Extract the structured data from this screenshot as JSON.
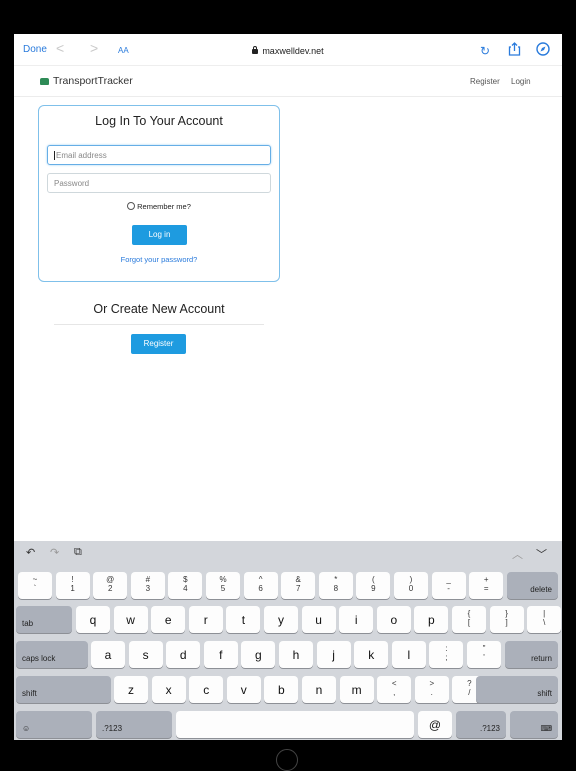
{
  "browser": {
    "done_label": "Done",
    "back_glyph": "<",
    "forward_glyph": ">",
    "text_size_label": "AA",
    "url": "maxwelldev.net",
    "reload_glyph": "↻"
  },
  "site": {
    "brand": "TransportTracker",
    "nav": {
      "register": "Register",
      "login": "Login"
    }
  },
  "login": {
    "title": "Log In To Your Account",
    "email_placeholder": "Email address",
    "password_placeholder": "Password",
    "remember_label": "Remember me?",
    "login_button": "Log in",
    "forgot_link": "Forgot your password?"
  },
  "create": {
    "title": "Or Create New Account",
    "register_button": "Register"
  },
  "keyboard": {
    "toolbar": {
      "undo": "↶",
      "redo": "↷",
      "paste": "⧉",
      "up": "︿",
      "down": "﹀"
    },
    "row1": [
      {
        "top": "~",
        "bottom": "`"
      },
      {
        "top": "!",
        "bottom": "1"
      },
      {
        "top": "@",
        "bottom": "2"
      },
      {
        "top": "#",
        "bottom": "3"
      },
      {
        "top": "$",
        "bottom": "4"
      },
      {
        "top": "%",
        "bottom": "5"
      },
      {
        "top": "^",
        "bottom": "6"
      },
      {
        "top": "&",
        "bottom": "7"
      },
      {
        "top": "*",
        "bottom": "8"
      },
      {
        "top": "(",
        "bottom": "9"
      },
      {
        "top": ")",
        "bottom": "0"
      },
      {
        "top": "_",
        "bottom": "-"
      },
      {
        "top": "+",
        "bottom": "="
      }
    ],
    "delete": "delete",
    "tab": "tab",
    "row2": [
      "q",
      "w",
      "e",
      "r",
      "t",
      "y",
      "u",
      "i",
      "o",
      "p"
    ],
    "row2_sym": [
      {
        "top": "{",
        "bottom": "["
      },
      {
        "top": "}",
        "bottom": "]"
      },
      {
        "top": "|",
        "bottom": "\\"
      }
    ],
    "caps": "caps lock",
    "row3": [
      "a",
      "s",
      "d",
      "f",
      "g",
      "h",
      "j",
      "k",
      "l"
    ],
    "row3_sym": [
      {
        "top": ":",
        "bottom": ";"
      },
      {
        "top": "\"",
        "bottom": "'"
      }
    ],
    "return": "return",
    "shift": "shift",
    "row4": [
      "z",
      "x",
      "c",
      "v",
      "b",
      "n",
      "m"
    ],
    "row4_sym": [
      {
        "top": "<",
        "bottom": ","
      },
      {
        "top": ">",
        "bottom": "."
      },
      {
        "top": "?",
        "bottom": "/"
      }
    ],
    "emoji": "☺",
    "num": ".?123",
    "at": "@",
    "hide": "⌨"
  }
}
